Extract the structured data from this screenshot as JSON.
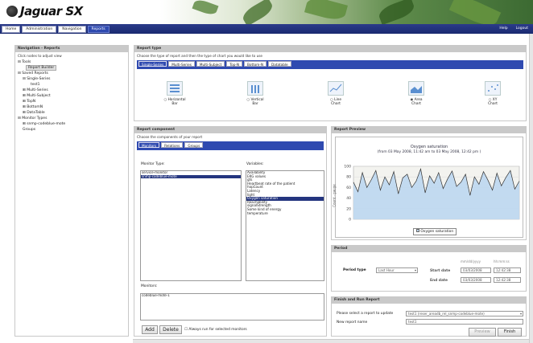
{
  "app": {
    "title": "Jaguar SX"
  },
  "nav": {
    "tabs": [
      {
        "label": "Home"
      },
      {
        "label": "Administration"
      },
      {
        "label": "Navigation"
      },
      {
        "label": "Reports"
      }
    ],
    "help": "Help",
    "logout": "Logout"
  },
  "navigation": {
    "title": "Navigation - Reports",
    "hint": "Click nodes to adjust view",
    "tree": [
      "Tools",
      "Report Builder",
      "Saved Reports",
      "Single-Series",
      "test1",
      "Multi-Series",
      "Multi-Subject",
      "TopN",
      "BottomN",
      "DataTable",
      "Monitor Types",
      "snmp-codeblue-mote",
      "Groups"
    ]
  },
  "report_type": {
    "title": "Report type",
    "hint": "Choose the type of report and then the type of chart you would like to use",
    "tabs": [
      "Single-Series",
      "Multi-Series",
      "Multi-Subject",
      "Top-N",
      "Bottom-N",
      "Datatable"
    ],
    "charts": [
      {
        "line1": "Horizontal",
        "line2": "Bar",
        "icon": "horizontal-bar-chart-icon"
      },
      {
        "line1": "Vertical",
        "line2": "Bar",
        "icon": "vertical-bar-chart-icon"
      },
      {
        "line1": "Line",
        "line2": "Chart",
        "icon": "line-chart-icon"
      },
      {
        "line1": "Area",
        "line2": "Chart",
        "icon": "area-chart-icon"
      },
      {
        "line1": "XY",
        "line2": "Chart",
        "icon": "xy-chart-icon"
      }
    ],
    "selected": "Area"
  },
  "component": {
    "title": "Report component",
    "hint": "Choose the components of your report",
    "tabs": [
      "Monitors",
      "Relations",
      "Groups"
    ],
    "monitor_type_label": "Monitor Type:",
    "variables_label": "Variables:",
    "monitor_types": [
      "service-monitor",
      "snmp-codeblue-mote"
    ],
    "variables": [
      "Availability",
      "EKG values",
      "gts",
      "Heartbeat rate of the patient",
      "hopCount",
      "Latency",
      "light",
      "Oxygen saturation",
      "Reachability",
      "signalStrength",
      "Some kind of energy",
      "temperature"
    ],
    "selected_variable": "Oxygen saturation",
    "monitors_label": "Monitors:",
    "monitors": [
      "codeblue-mote-1"
    ],
    "add": "Add",
    "delete": "Delete",
    "always_run": "Always run for selected monitors"
  },
  "preview": {
    "title": "Report Preview"
  },
  "chart_data": {
    "type": "area",
    "title": "Oxygen saturation",
    "subtitle": "(from 03 May 2008, 11:42 am to 03 May 2008, 12:42 pm )",
    "ylabel": "Count - gauge",
    "ylim": [
      0,
      100
    ],
    "yticks": [
      0,
      20,
      40,
      60,
      80,
      100
    ],
    "legend": "Oxygen saturation",
    "fill": "#bcd7ef",
    "line": "#333333",
    "y": [
      70,
      52,
      88,
      60,
      75,
      92,
      55,
      80,
      65,
      90,
      48,
      78,
      85,
      60,
      72,
      95,
      50,
      82,
      68,
      88,
      58,
      76,
      91,
      62,
      70,
      85,
      45,
      80,
      66,
      90,
      74,
      55,
      87,
      63,
      79,
      92,
      57,
      72
    ]
  },
  "period": {
    "title": "Period",
    "type_label": "Period type",
    "type_value": "Last Hour",
    "fmt_date": "mm/dd/yyyy",
    "fmt_time": "hh:mm:ss",
    "start_label": "Start date",
    "start_date": "03/03/2008",
    "start_time": "12:42:38",
    "end_label": "End date",
    "end_date": "03/03/2008",
    "end_time": "12:42:38"
  },
  "finish": {
    "title": "Finish and Run Report",
    "select_label": "Please select a report to update",
    "select_value": "test1 (reser_areadb_rel_snmp-codeblue-mote)",
    "name_label": "New report name",
    "name_value": "test1",
    "preview": "Preview",
    "finish": "Finish"
  }
}
